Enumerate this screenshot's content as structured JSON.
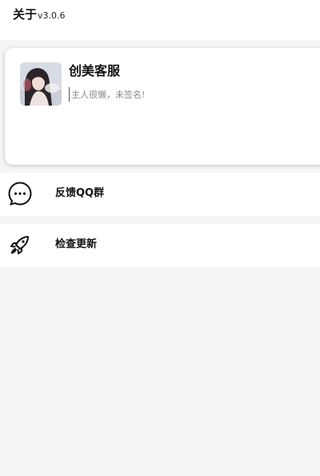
{
  "header": {
    "title": "关于",
    "version": "v3.0.6"
  },
  "profile": {
    "name": "创美客服",
    "signature_placeholder": "主人很懒，未签名!"
  },
  "menu": [
    {
      "label": "反馈QQ群",
      "icon": "chat-bubble-icon"
    },
    {
      "label": "检查更新",
      "icon": "rocket-icon"
    }
  ],
  "colors": {
    "background": "#f5f5f5",
    "surface": "#ffffff",
    "text": "#111111",
    "muted_text": "#888888"
  }
}
